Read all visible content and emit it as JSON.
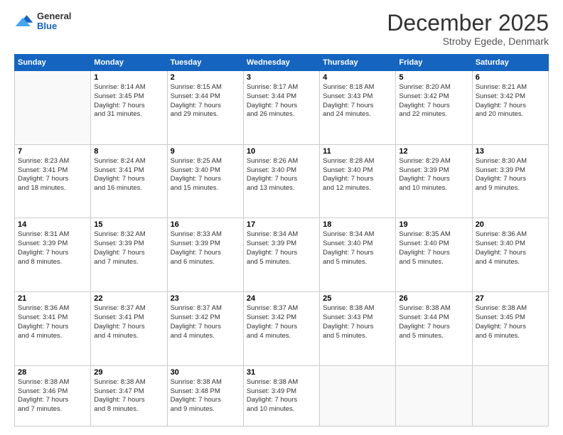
{
  "header": {
    "logo": {
      "line1": "General",
      "line2": "Blue"
    },
    "title": "December 2025",
    "subtitle": "Stroby Egede, Denmark"
  },
  "calendar": {
    "days_of_week": [
      "Sunday",
      "Monday",
      "Tuesday",
      "Wednesday",
      "Thursday",
      "Friday",
      "Saturday"
    ],
    "rows": [
      [
        {
          "day": "",
          "text": ""
        },
        {
          "day": "1",
          "text": "Sunrise: 8:14 AM\nSunset: 3:45 PM\nDaylight: 7 hours\nand 31 minutes."
        },
        {
          "day": "2",
          "text": "Sunrise: 8:15 AM\nSunset: 3:44 PM\nDaylight: 7 hours\nand 29 minutes."
        },
        {
          "day": "3",
          "text": "Sunrise: 8:17 AM\nSunset: 3:44 PM\nDaylight: 7 hours\nand 26 minutes."
        },
        {
          "day": "4",
          "text": "Sunrise: 8:18 AM\nSunset: 3:43 PM\nDaylight: 7 hours\nand 24 minutes."
        },
        {
          "day": "5",
          "text": "Sunrise: 8:20 AM\nSunset: 3:42 PM\nDaylight: 7 hours\nand 22 minutes."
        },
        {
          "day": "6",
          "text": "Sunrise: 8:21 AM\nSunset: 3:42 PM\nDaylight: 7 hours\nand 20 minutes."
        }
      ],
      [
        {
          "day": "7",
          "text": "Sunrise: 8:23 AM\nSunset: 3:41 PM\nDaylight: 7 hours\nand 18 minutes."
        },
        {
          "day": "8",
          "text": "Sunrise: 8:24 AM\nSunset: 3:41 PM\nDaylight: 7 hours\nand 16 minutes."
        },
        {
          "day": "9",
          "text": "Sunrise: 8:25 AM\nSunset: 3:40 PM\nDaylight: 7 hours\nand 15 minutes."
        },
        {
          "day": "10",
          "text": "Sunrise: 8:26 AM\nSunset: 3:40 PM\nDaylight: 7 hours\nand 13 minutes."
        },
        {
          "day": "11",
          "text": "Sunrise: 8:28 AM\nSunset: 3:40 PM\nDaylight: 7 hours\nand 12 minutes."
        },
        {
          "day": "12",
          "text": "Sunrise: 8:29 AM\nSunset: 3:39 PM\nDaylight: 7 hours\nand 10 minutes."
        },
        {
          "day": "13",
          "text": "Sunrise: 8:30 AM\nSunset: 3:39 PM\nDaylight: 7 hours\nand 9 minutes."
        }
      ],
      [
        {
          "day": "14",
          "text": "Sunrise: 8:31 AM\nSunset: 3:39 PM\nDaylight: 7 hours\nand 8 minutes."
        },
        {
          "day": "15",
          "text": "Sunrise: 8:32 AM\nSunset: 3:39 PM\nDaylight: 7 hours\nand 7 minutes."
        },
        {
          "day": "16",
          "text": "Sunrise: 8:33 AM\nSunset: 3:39 PM\nDaylight: 7 hours\nand 6 minutes."
        },
        {
          "day": "17",
          "text": "Sunrise: 8:34 AM\nSunset: 3:39 PM\nDaylight: 7 hours\nand 5 minutes."
        },
        {
          "day": "18",
          "text": "Sunrise: 8:34 AM\nSunset: 3:40 PM\nDaylight: 7 hours\nand 5 minutes."
        },
        {
          "day": "19",
          "text": "Sunrise: 8:35 AM\nSunset: 3:40 PM\nDaylight: 7 hours\nand 5 minutes."
        },
        {
          "day": "20",
          "text": "Sunrise: 8:36 AM\nSunset: 3:40 PM\nDaylight: 7 hours\nand 4 minutes."
        }
      ],
      [
        {
          "day": "21",
          "text": "Sunrise: 8:36 AM\nSunset: 3:41 PM\nDaylight: 7 hours\nand 4 minutes."
        },
        {
          "day": "22",
          "text": "Sunrise: 8:37 AM\nSunset: 3:41 PM\nDaylight: 7 hours\nand 4 minutes."
        },
        {
          "day": "23",
          "text": "Sunrise: 8:37 AM\nSunset: 3:42 PM\nDaylight: 7 hours\nand 4 minutes."
        },
        {
          "day": "24",
          "text": "Sunrise: 8:37 AM\nSunset: 3:42 PM\nDaylight: 7 hours\nand 4 minutes."
        },
        {
          "day": "25",
          "text": "Sunrise: 8:38 AM\nSunset: 3:43 PM\nDaylight: 7 hours\nand 5 minutes."
        },
        {
          "day": "26",
          "text": "Sunrise: 8:38 AM\nSunset: 3:44 PM\nDaylight: 7 hours\nand 5 minutes."
        },
        {
          "day": "27",
          "text": "Sunrise: 8:38 AM\nSunset: 3:45 PM\nDaylight: 7 hours\nand 6 minutes."
        }
      ],
      [
        {
          "day": "28",
          "text": "Sunrise: 8:38 AM\nSunset: 3:46 PM\nDaylight: 7 hours\nand 7 minutes."
        },
        {
          "day": "29",
          "text": "Sunrise: 8:38 AM\nSunset: 3:47 PM\nDaylight: 7 hours\nand 8 minutes."
        },
        {
          "day": "30",
          "text": "Sunrise: 8:38 AM\nSunset: 3:48 PM\nDaylight: 7 hours\nand 9 minutes."
        },
        {
          "day": "31",
          "text": "Sunrise: 8:38 AM\nSunset: 3:49 PM\nDaylight: 7 hours\nand 10 minutes."
        },
        {
          "day": "",
          "text": ""
        },
        {
          "day": "",
          "text": ""
        },
        {
          "day": "",
          "text": ""
        }
      ]
    ]
  }
}
